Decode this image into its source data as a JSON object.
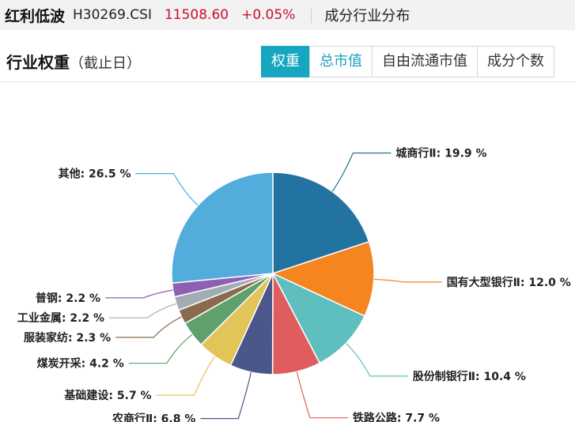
{
  "header": {
    "index_name": "红利低波",
    "index_code": "H30269.CSI",
    "price": "11508.60",
    "change": "+0.05%",
    "section": "成分行业分布",
    "price_color": "#c8102e"
  },
  "toolbar": {
    "title": "行业权重",
    "subtitle": "（截止日）",
    "tabs": [
      {
        "label": "权重",
        "active": true
      },
      {
        "label": "总市值",
        "active": false
      },
      {
        "label": "自由流通市值",
        "active": false
      },
      {
        "label": "成分个数",
        "active": false
      }
    ],
    "accent_color": "#17a6c1"
  },
  "chart_data": {
    "type": "pie",
    "title": "",
    "unit": "%",
    "slices": [
      {
        "label": "城商行Ⅱ",
        "value": 19.9,
        "display": "19.9 %",
        "color": "#22739f"
      },
      {
        "label": "国有大型银行Ⅱ",
        "value": 12.0,
        "display": "12.0 %",
        "color": "#f5851f"
      },
      {
        "label": "股份制银行Ⅱ",
        "value": 10.4,
        "display": "10.4 %",
        "color": "#5fbfbf"
      },
      {
        "label": "铁路公路",
        "value": 7.7,
        "display": "7.7 %",
        "color": "#e05d5d"
      },
      {
        "label": "农商行Ⅱ",
        "value": 6.8,
        "display": "6.8 %",
        "color": "#4b568a"
      },
      {
        "label": "基础建设",
        "value": 5.7,
        "display": "5.7 %",
        "color": "#e2c459"
      },
      {
        "label": "煤炭开采",
        "value": 4.2,
        "display": "4.2 %",
        "color": "#5fa06e"
      },
      {
        "label": "服装家纺",
        "value": 2.3,
        "display": "2.3 %",
        "color": "#8b6b4d"
      },
      {
        "label": "工业金属",
        "value": 2.2,
        "display": "2.2 %",
        "color": "#a2acb5"
      },
      {
        "label": "普钢",
        "value": 2.2,
        "display": "2.2 %",
        "color": "#8f5fb2"
      },
      {
        "label": "其他",
        "value": 26.5,
        "display": "26.5 %",
        "color": "#52acdc"
      }
    ]
  }
}
